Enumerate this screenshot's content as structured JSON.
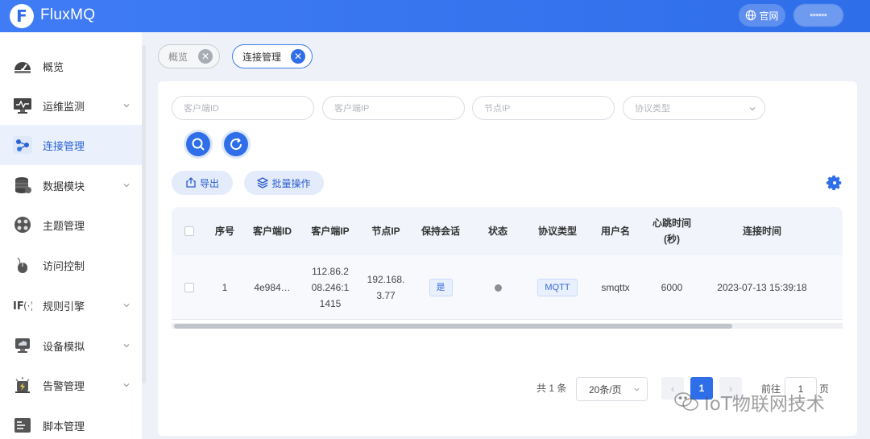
{
  "header": {
    "logo_letter": "F",
    "app_name": "FluxMQ",
    "official_site": "官网",
    "user_name": "••••••"
  },
  "sidebar": {
    "items": [
      {
        "label": "概览",
        "icon": "gauge-icon",
        "expandable": false,
        "active": false
      },
      {
        "label": "运维监测",
        "icon": "monitor-icon",
        "expandable": true,
        "active": false
      },
      {
        "label": "连接管理",
        "icon": "network-icon",
        "expandable": false,
        "active": true
      },
      {
        "label": "数据模块",
        "icon": "database-icon",
        "expandable": true,
        "active": false
      },
      {
        "label": "主题管理",
        "icon": "topic-icon",
        "expandable": false,
        "active": false
      },
      {
        "label": "访问控制",
        "icon": "mouse-icon",
        "expandable": false,
        "active": false
      },
      {
        "label": "规则引擎",
        "icon": "rule-engine-icon",
        "expandable": true,
        "active": false
      },
      {
        "label": "设备模拟",
        "icon": "device-icon",
        "expandable": true,
        "active": false
      },
      {
        "label": "告警管理",
        "icon": "alarm-icon",
        "expandable": true,
        "active": false
      },
      {
        "label": "脚本管理",
        "icon": "script-icon",
        "expandable": false,
        "active": false
      }
    ]
  },
  "tabs": [
    {
      "label": "概览",
      "active": false
    },
    {
      "label": "连接管理",
      "active": true
    }
  ],
  "filters": {
    "client_id_placeholder": "客户端ID",
    "client_ip_placeholder": "客户端IP",
    "node_ip_placeholder": "节点IP",
    "protocol_placeholder": "协议类型"
  },
  "actions": {
    "export_label": "导出",
    "batch_label": "批量操作"
  },
  "table": {
    "columns": [
      "序号",
      "客户端ID",
      "客户端IP",
      "节点IP",
      "保持会话",
      "状态",
      "协议类型",
      "用户名",
      "心跳时间(秒)",
      "连接时间"
    ],
    "heartbeat_header_line1": "心跳时间",
    "heartbeat_header_line2": "(秒)",
    "rows": [
      {
        "index": "1",
        "client_id": "4e984…",
        "client_ip_l1": "112.86.2",
        "client_ip_l2": "08.246:1",
        "client_ip_l3": "1415",
        "node_ip_l1": "192.168.",
        "node_ip_l2": "3.77",
        "keep_session": "是",
        "protocol": "MQTT",
        "username": "smqttx",
        "heartbeat": "6000",
        "connect_time": "2023-07-13 15:39:18"
      }
    ]
  },
  "pagination": {
    "total_text": "共 1 条",
    "page_size": "20条/页",
    "current_page": "1",
    "goto_label": "前往",
    "goto_value": "1",
    "page_suffix": "页"
  },
  "watermark": {
    "text": "IoT物联网技术"
  },
  "colors": {
    "primary": "#2f6ee9",
    "header_bg": "#3f7cf5",
    "active_nav_bg": "#eaf1fd",
    "page_bg": "#eef2f8"
  }
}
